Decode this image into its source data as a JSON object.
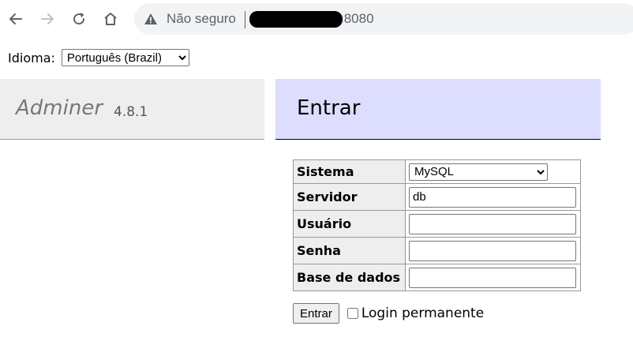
{
  "browser": {
    "address_status": "Não seguro",
    "address_host": ":8080"
  },
  "language": {
    "label": "Idioma:",
    "selected": "Português (Brazil)"
  },
  "menu": {
    "brand": "Adminer",
    "version": "4.8.1"
  },
  "content": {
    "title": "Entrar"
  },
  "login_form": {
    "rows": [
      {
        "label": "Sistema",
        "type": "select",
        "value": "MySQL"
      },
      {
        "label": "Servidor",
        "type": "text",
        "value": "db"
      },
      {
        "label": "Usuário",
        "type": "text",
        "value": ""
      },
      {
        "label": "Senha",
        "type": "password",
        "value": ""
      },
      {
        "label": "Base de dados",
        "type": "text",
        "value": ""
      }
    ],
    "submit_label": "Entrar",
    "permanent_label": "Login permanente",
    "permanent_checked": false
  }
}
